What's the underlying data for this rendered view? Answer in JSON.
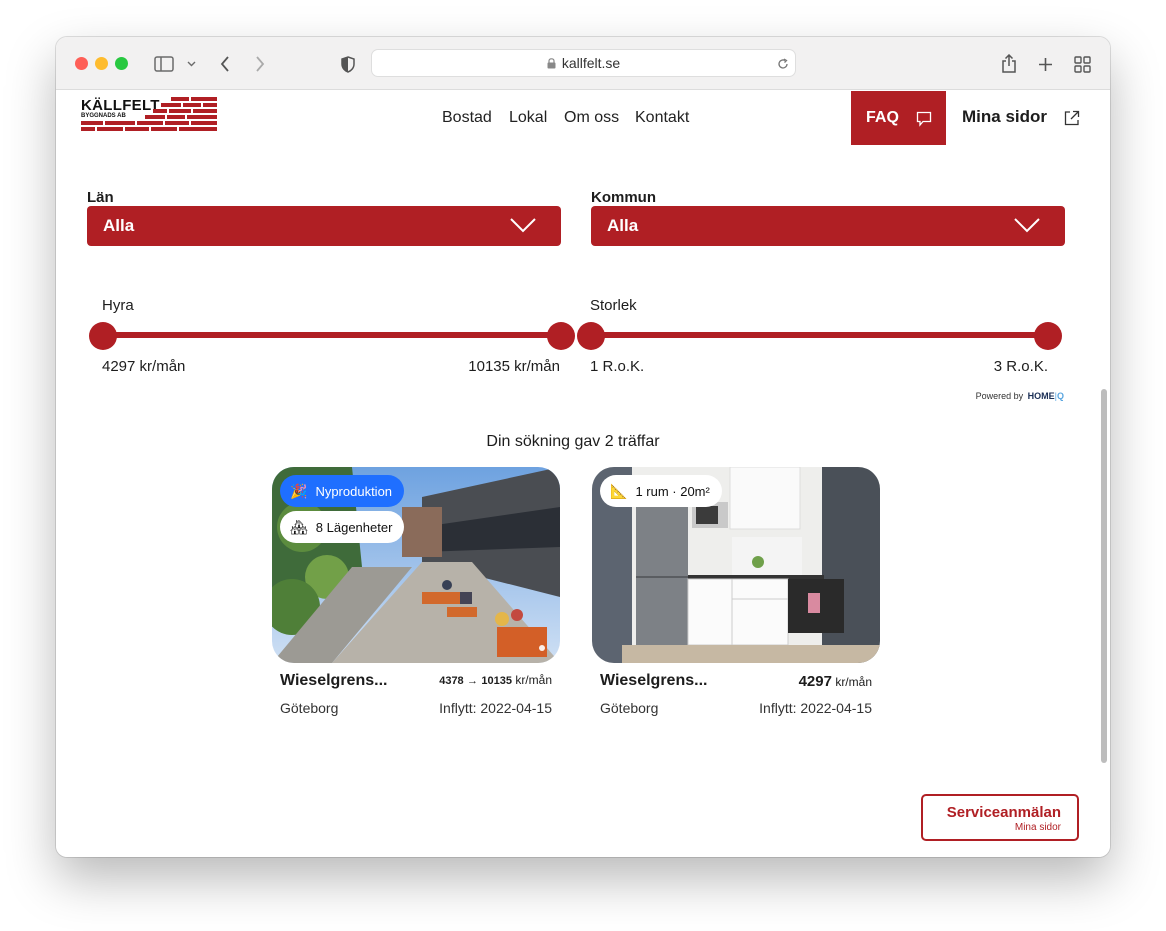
{
  "browser": {
    "url": "kallfelt.se"
  },
  "header": {
    "logo_title": "KÄLLFELT",
    "logo_subtitle": "BYGGNADS AB",
    "nav": [
      "Bostad",
      "Lokal",
      "Om oss",
      "Kontakt"
    ],
    "faq_label": "FAQ",
    "mina_sidor_label": "Mina sidor"
  },
  "filters": {
    "lan": {
      "label": "Län",
      "value": "Alla"
    },
    "kommun": {
      "label": "Kommun",
      "value": "Alla"
    },
    "hyra": {
      "label": "Hyra",
      "min": "4297 kr/mån",
      "max": "10135 kr/mån",
      "range_fraction": [
        0.0,
        1.0
      ]
    },
    "storlek": {
      "label": "Storlek",
      "min": "1 R.o.K.",
      "max": "3 R.o.K.",
      "range_fraction": [
        0.0,
        1.0
      ]
    },
    "powered_by": "Powered by",
    "powered_brand": "HOME",
    "powered_brand_suffix": "Q"
  },
  "results": {
    "summary": "Din sökning gav 2 träffar",
    "listings": [
      {
        "badge1": "Nyproduktion",
        "badge1_icon": "🎉",
        "badge2": "8 Lägenheter",
        "badge2_icon": "🏘",
        "name": "Wieselgrens...",
        "price_from": "4378",
        "price_arrow": "→",
        "price_to": "10135",
        "price_unit": "kr/mån",
        "city": "Göteborg",
        "inflytt": "Inflytt: 2022-04-15"
      },
      {
        "badge1": "1 rum · 20m²",
        "badge1_icon": "📐",
        "name": "Wieselgrens...",
        "price": "4297",
        "price_unit": "kr/mån",
        "city": "Göteborg",
        "inflytt": "Inflytt: 2022-04-15"
      }
    ]
  },
  "service_button": {
    "label": "Serviceanmälan",
    "sublabel": "Mina sidor"
  },
  "colors": {
    "brand_red": "#b01f24",
    "badge_blue": "#1f6fff"
  }
}
